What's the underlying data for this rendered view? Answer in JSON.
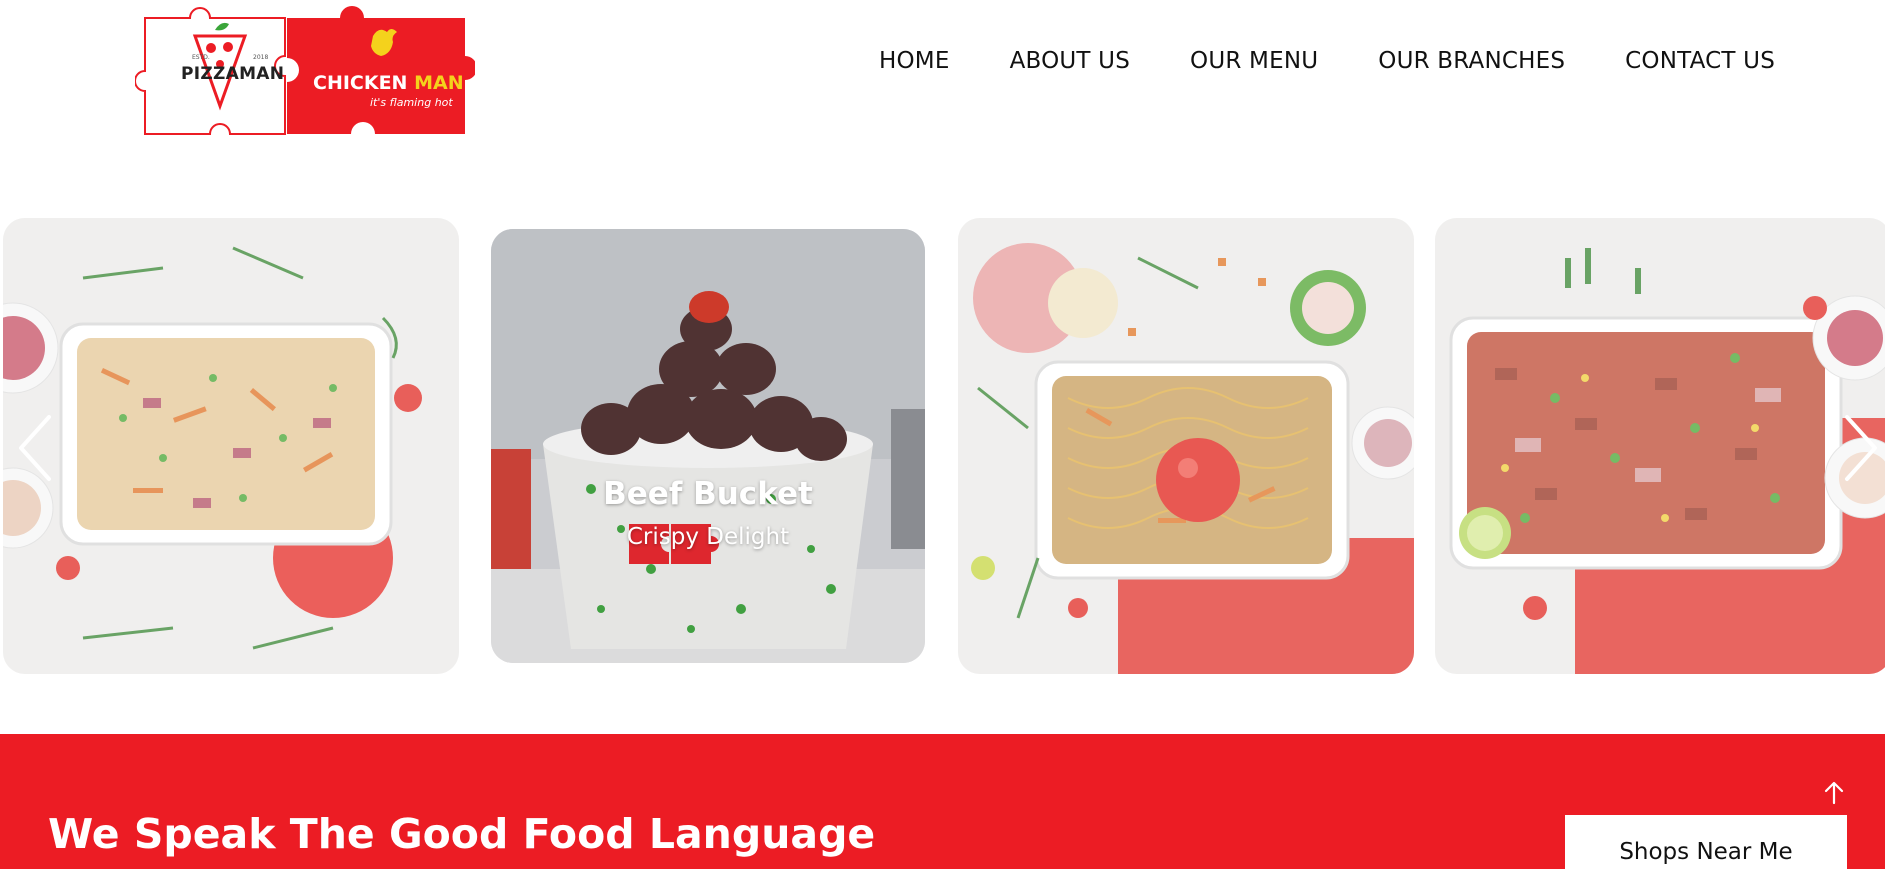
{
  "brand": {
    "pizzaman": "PIZZAMAN",
    "pizzaman_est": "ESTD.",
    "pizzaman_year": "2018",
    "chickenman_first": "CHICKEN",
    "chickenman_second": "MAN",
    "chickenman_tagline": "it's flaming hot",
    "colors": {
      "red": "#ec1c24",
      "yellow": "#f4d21c"
    }
  },
  "nav": {
    "items": [
      "HOME",
      "ABOUT US",
      "OUR MENU",
      "OUR BRANCHES",
      "CONTACT US"
    ]
  },
  "carousel": {
    "slides": [
      {
        "image": "fried-rice-tray"
      },
      {
        "image": "beef-bucket",
        "title": "Beef Bucket",
        "subtitle": "Crispy Delight"
      },
      {
        "image": "noodles-tray"
      },
      {
        "image": "jollof-rice-tray"
      }
    ],
    "prev_icon": "chevron-left-icon",
    "next_icon": "chevron-right-icon"
  },
  "band": {
    "title": "We Speak The Good Food Language",
    "shops_button": "Shops Near Me",
    "scroll_top_icon": "arrow-up-icon"
  }
}
